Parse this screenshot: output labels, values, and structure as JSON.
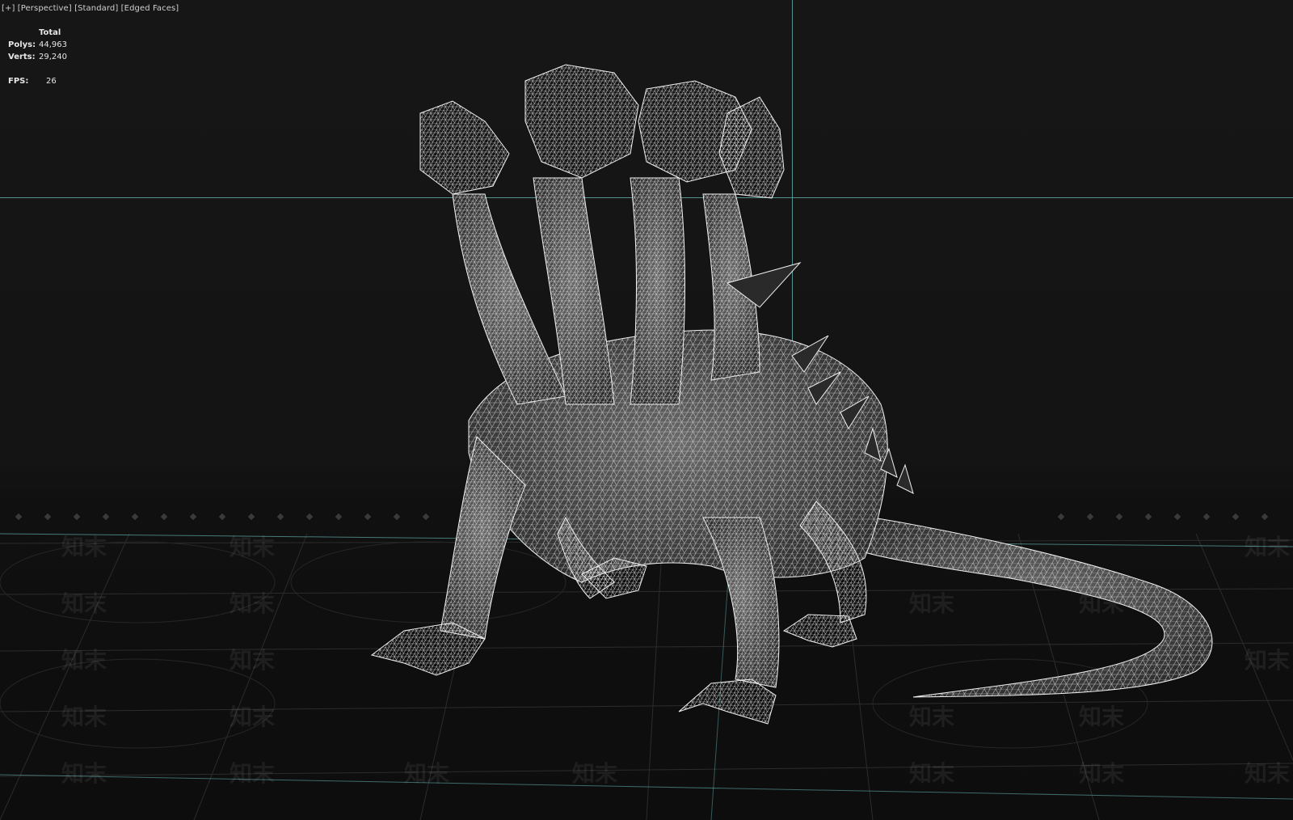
{
  "viewport": {
    "label_plus": "[+]",
    "label_view": "[Perspective]",
    "label_shading": "[Standard]",
    "label_mode": "[Edged Faces]"
  },
  "stats": {
    "header": "Total",
    "polys_label": "Polys:",
    "polys_value": "44,963",
    "verts_label": "Verts:",
    "verts_value": "29,240",
    "fps_label": "FPS:",
    "fps_value": "26"
  },
  "watermark": {
    "text": "知末"
  },
  "colors": {
    "background": "#151515",
    "crosshair": "#5fa8a6",
    "wireframe": "#e8e8e8",
    "grid": "#3a3a3a"
  }
}
